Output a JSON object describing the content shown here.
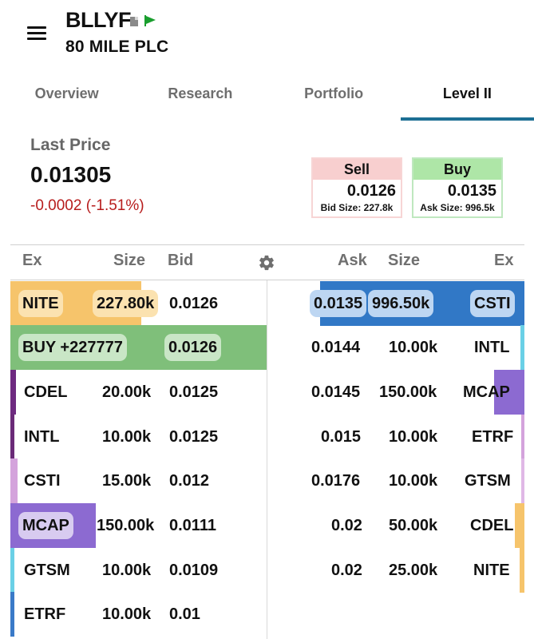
{
  "header": {
    "ticker": "BLLYF",
    "company": "80 MILE PLC"
  },
  "tabs": [
    {
      "label": "Overview"
    },
    {
      "label": "Research"
    },
    {
      "label": "Portfolio"
    },
    {
      "label": "Level II"
    }
  ],
  "quote": {
    "last_price_label": "Last Price",
    "last_price": "0.01305",
    "change": "-0.0002 (-1.51%)",
    "sell": {
      "label": "Sell",
      "price": "0.0126",
      "size": "Bid Size: 227.8k"
    },
    "buy": {
      "label": "Buy",
      "price": "0.0135",
      "size": "Ask Size: 996.5k"
    }
  },
  "columns": {
    "ex": "Ex",
    "size": "Size",
    "bid": "Bid",
    "ask": "Ask"
  },
  "bids": [
    {
      "ex": "NITE",
      "size": "227.80k",
      "price": "0.0126",
      "color": "#f6c46b"
    },
    {
      "ex": "BUY +227777",
      "size": "",
      "price": "0.0126",
      "color": "#7fbf7a"
    },
    {
      "ex": "CDEL",
      "size": "20.00k",
      "price": "0.0125",
      "color": "#6e2a80"
    },
    {
      "ex": "INTL",
      "size": "10.00k",
      "price": "0.0125",
      "color": "#6a2a78"
    },
    {
      "ex": "CSTI",
      "size": "15.00k",
      "price": "0.012",
      "color": "#d4a3dc"
    },
    {
      "ex": "MCAP",
      "size": "150.00k",
      "price": "0.0111",
      "color": "#8c6ad1"
    },
    {
      "ex": "GTSM",
      "size": "10.00k",
      "price": "0.0109",
      "color": "#6ad0e6"
    },
    {
      "ex": "ETRF",
      "size": "10.00k",
      "price": "0.01",
      "color": "#3a7ac8"
    }
  ],
  "asks": [
    {
      "price": "0.0135",
      "size": "996.50k",
      "ex": "CSTI",
      "color": "#3178c6"
    },
    {
      "price": "0.0144",
      "size": "10.00k",
      "ex": "INTL",
      "color": "#6ad0e6"
    },
    {
      "price": "0.0145",
      "size": "150.00k",
      "ex": "MCAP",
      "color": "#8c6ad1"
    },
    {
      "price": "0.015",
      "size": "10.00k",
      "ex": "ETRF",
      "color": "#d4a3dc"
    },
    {
      "price": "0.0176",
      "size": "10.00k",
      "ex": "GTSM",
      "color": "#e0b8e6"
    },
    {
      "price": "0.02",
      "size": "50.00k",
      "ex": "CDEL",
      "color": "#f6c46b"
    },
    {
      "price": "0.02",
      "size": "25.00k",
      "ex": "NITE",
      "color": "#f6c46b"
    }
  ]
}
